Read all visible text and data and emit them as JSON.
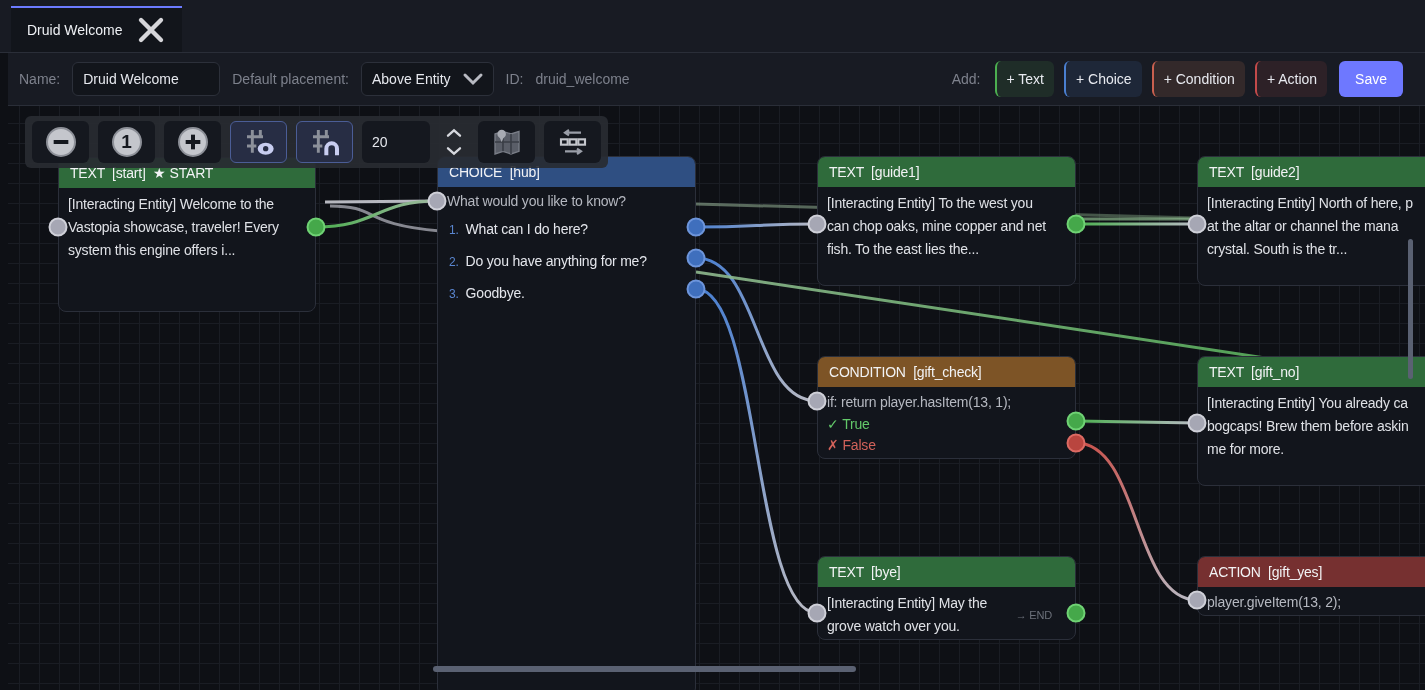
{
  "tab": {
    "title": "Druid Welcome",
    "selected": true
  },
  "toolbar": {
    "name_label": "Name:",
    "name_value": "Druid Welcome",
    "placement_label": "Default placement:",
    "placement_value": "Above Entity",
    "id_label": "ID:",
    "id_value": "druid_welcome",
    "add_label": "Add:",
    "add_buttons": [
      {
        "label": "+ Text",
        "kind": "text"
      },
      {
        "label": "+ Choice",
        "kind": "choice"
      },
      {
        "label": "+ Condition",
        "kind": "condition"
      },
      {
        "label": "+ Action",
        "kind": "action"
      }
    ],
    "save": "Save"
  },
  "view_toolbar": {
    "reset_label": "1",
    "grid_visible": true,
    "snap": true,
    "grid_size": "20"
  },
  "nodes": [
    {
      "kind": "text",
      "header": "TEXT  [start]  ★ START",
      "lines": [
        "[Interacting Entity] Welcome to the",
        "Vastopia showcase, traveler! Every",
        "system this engine offers i..."
      ]
    },
    {
      "kind": "choice",
      "header": "CHOICE  [hub]",
      "lines": [
        "What would you like to know?"
      ],
      "options": [
        {
          "number": "1.",
          "label": "What can I do here?"
        },
        {
          "number": "2.",
          "label": "Do you have anything for me?"
        },
        {
          "number": "3.",
          "label": "Goodbye."
        }
      ]
    },
    {
      "kind": "text",
      "header": "TEXT  [guide1]",
      "lines": [
        "[Interacting Entity] To the west you",
        "can chop oaks, mine copper and net",
        "fish. To the east lies the..."
      ]
    },
    {
      "kind": "text",
      "header": "TEXT  [guide2]",
      "lines": [
        "[Interacting Entity] North of here, p",
        "at the altar or channel the mana",
        "crystal. South is the tr..."
      ]
    },
    {
      "kind": "condition",
      "header": "CONDITION  [gift_check]",
      "lines": [
        "if: return player.hasItem(13, 1);"
      ],
      "branches": [
        {
          "label": "✓ True",
          "kind": "true"
        },
        {
          "label": "✗ False",
          "kind": "false"
        }
      ]
    },
    {
      "kind": "text",
      "header": "TEXT  [gift_no]",
      "lines": [
        "[Interacting Entity] You already ca",
        "bogcaps! Brew them before askin",
        "me for more."
      ]
    },
    {
      "kind": "text",
      "header": "TEXT  [bye]",
      "lines": [
        "[Interacting Entity] May the",
        "grove watch over you."
      ],
      "end_label": "→ END"
    },
    {
      "kind": "action",
      "header": "ACTION  [gift_yes]",
      "lines": [
        "player.giveItem(13, 2);"
      ]
    }
  ]
}
